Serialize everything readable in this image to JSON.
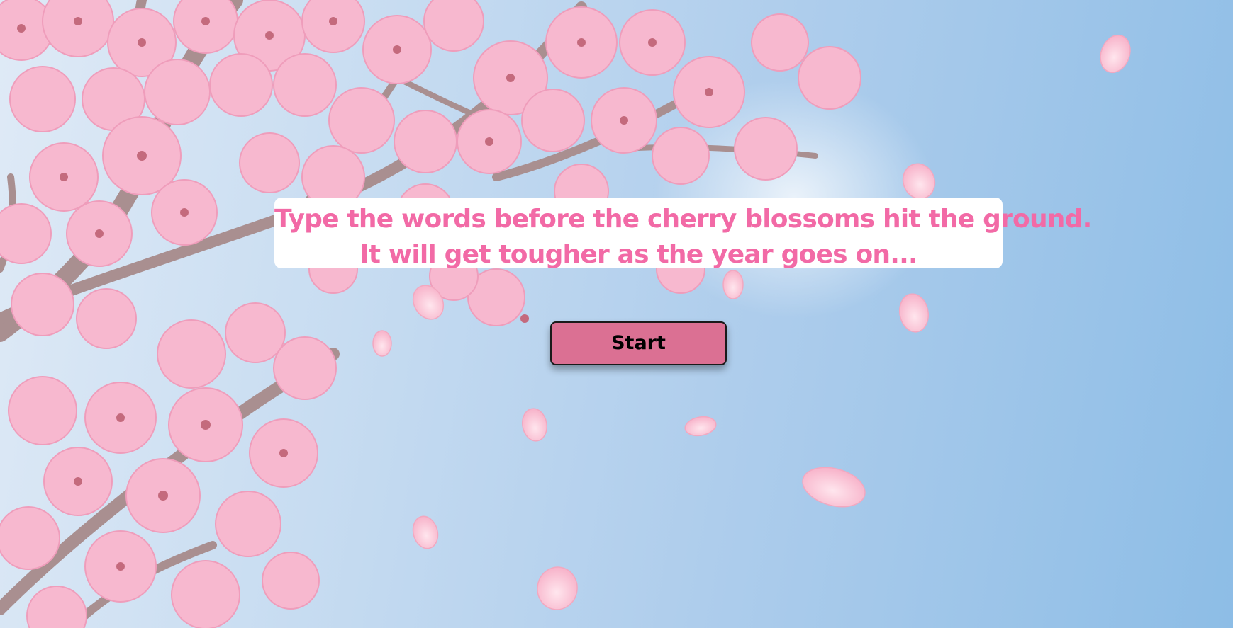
{
  "game": {
    "instructions": {
      "line1": "Type the words before the cherry blossoms hit the ground.",
      "line2": "It will get tougher as the year goes on..."
    },
    "start_label": "Start"
  },
  "theme": {
    "sky_light": "#dfeaf6",
    "sky_dark": "#8dbde6",
    "petal_pink": "#f7b8cf",
    "petal_deep": "#ef8fb2",
    "branch": "#a98f90",
    "text_pink": "#f26aa6",
    "button_pink": "#db7093"
  }
}
